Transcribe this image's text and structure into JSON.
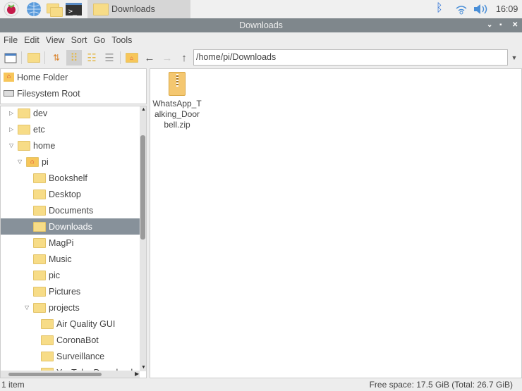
{
  "taskbar": {
    "task_label": "Downloads",
    "clock": "16:09",
    "icons": [
      "raspberry-menu-icon",
      "web-browser-icon",
      "file-manager-icon",
      "terminal-icon",
      "bluetooth-icon",
      "wifi-icon",
      "volume-icon"
    ]
  },
  "window": {
    "title": "Downloads"
  },
  "menu": [
    "File",
    "Edit",
    "View",
    "Sort",
    "Go",
    "Tools"
  ],
  "location": {
    "path": "/home/pi/Downloads"
  },
  "places": [
    {
      "label": "Home Folder"
    },
    {
      "label": "Filesystem Root"
    }
  ],
  "tree": [
    {
      "label": "dev",
      "level": 0,
      "expander": "collapsed"
    },
    {
      "label": "etc",
      "level": 0,
      "expander": "collapsed"
    },
    {
      "label": "home",
      "level": 0,
      "expander": "expanded"
    },
    {
      "label": "pi",
      "level": 1,
      "expander": "expanded",
      "icon": "home"
    },
    {
      "label": "Bookshelf",
      "level": 2
    },
    {
      "label": "Desktop",
      "level": 2
    },
    {
      "label": "Documents",
      "level": 2
    },
    {
      "label": "Downloads",
      "level": 2,
      "selected": true
    },
    {
      "label": "MagPi",
      "level": 2
    },
    {
      "label": "Music",
      "level": 2
    },
    {
      "label": "pic",
      "level": 2
    },
    {
      "label": "Pictures",
      "level": 2
    },
    {
      "label": "projects",
      "level": 2,
      "expander": "expanded"
    },
    {
      "label": "Air Quality GUI",
      "level": 3
    },
    {
      "label": "CoronaBot",
      "level": 3
    },
    {
      "label": "Surveillance",
      "level": 3
    },
    {
      "label": "YouTube Download",
      "level": 3
    }
  ],
  "files": [
    {
      "name": "WhatsApp_Talking_Doorbell.zip",
      "line1": "WhatsApp_T",
      "line2": "alking_Door",
      "line3": "bell.zip"
    }
  ],
  "status": {
    "count": "1 item",
    "free": "Free space: 17.5 GiB (Total: 26.7 GiB)"
  }
}
